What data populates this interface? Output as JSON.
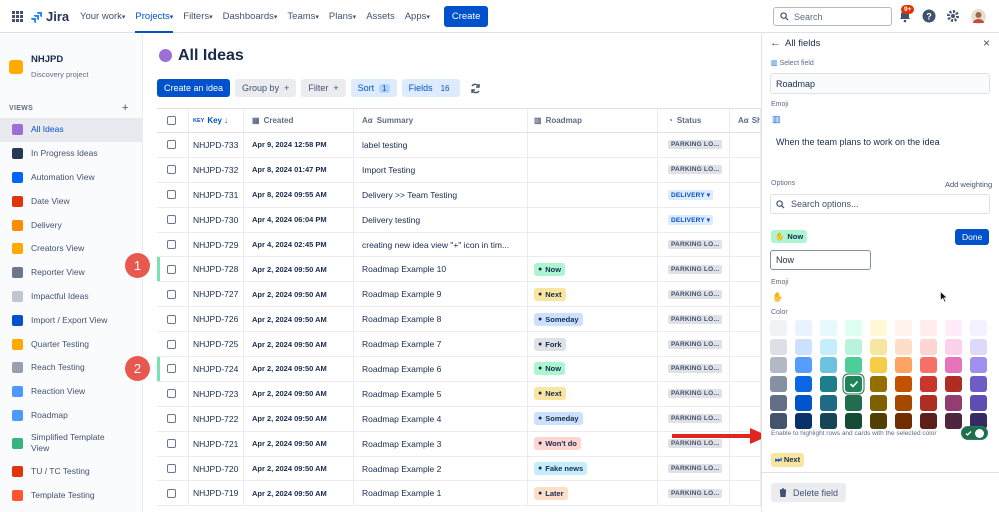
{
  "topbar": {
    "logo": "Jira",
    "nav": [
      "Your work",
      "Projects",
      "Filters",
      "Dashboards",
      "Teams",
      "Plans",
      "Assets",
      "Apps"
    ],
    "create": "Create",
    "search_placeholder": "Search",
    "badge": "9+"
  },
  "sidebar": {
    "project_name": "NHJPD",
    "project_type": "Discovery project",
    "views_header": "VIEWS",
    "views": [
      {
        "label": "All Ideas",
        "color": "#9d6fd6"
      },
      {
        "label": "In Progress Ideas",
        "color": "#253858"
      },
      {
        "label": "Automation View",
        "color": "#0065ff"
      },
      {
        "label": "Date View",
        "color": "#de350b"
      },
      {
        "label": "Delivery",
        "color": "#ff8b00"
      },
      {
        "label": "Creators View",
        "color": "#ffab00"
      },
      {
        "label": "Reporter View",
        "color": "#6b778c"
      },
      {
        "label": "Impactful Ideas",
        "color": "#c1c7d0"
      },
      {
        "label": "Import / Export View",
        "color": "#0052cc"
      },
      {
        "label": "Quarter Testing",
        "color": "#ffab00"
      },
      {
        "label": "Reach Testing",
        "color": "#97a0af"
      },
      {
        "label": "Reaction View",
        "color": "#4c9aff"
      },
      {
        "label": "Roadmap",
        "color": "#4c9aff"
      },
      {
        "label": "Simplified Template View",
        "color": "#36b37e"
      },
      {
        "label": "TU / TC Testing",
        "color": "#de350b"
      },
      {
        "label": "Template Testing",
        "color": "#ff5630"
      }
    ],
    "callout_1": "1",
    "callout_2": "2"
  },
  "main": {
    "title": "All Ideas",
    "toolbar": {
      "create": "Create an idea",
      "group_by": "Group by",
      "filter": "Filter",
      "sort": "Sort",
      "sort_count": "1",
      "fields": "Fields",
      "fields_count": "16"
    },
    "columns": {
      "key": "Key",
      "created": "Created",
      "summary": "Summary",
      "roadmap": "Roadmap",
      "status": "Status",
      "ashort": "Sh"
    },
    "rows": [
      {
        "key": "NHJPD-733",
        "created": "Apr 9, 2024 12:58 PM",
        "summary": "label testing",
        "roadmap": "",
        "roadmap_color": "",
        "status": "PARKING LO...",
        "deliv": false,
        "hl": false
      },
      {
        "key": "NHJPD-732",
        "created": "Apr 8, 2024 01:47 PM",
        "summary": "Import Testing",
        "roadmap": "",
        "roadmap_color": "",
        "status": "PARKING LO...",
        "deliv": false,
        "hl": false
      },
      {
        "key": "NHJPD-731",
        "created": "Apr 8, 2024 09:55 AM",
        "summary": "Delivery >> Team Testing",
        "roadmap": "",
        "roadmap_color": "",
        "status": "DELIVERY",
        "deliv": true,
        "hl": false
      },
      {
        "key": "NHJPD-730",
        "created": "Apr 4, 2024 06:04 PM",
        "summary": "Delivery testing",
        "roadmap": "",
        "roadmap_color": "",
        "status": "DELIVERY",
        "deliv": true,
        "hl": false
      },
      {
        "key": "NHJPD-729",
        "created": "Apr 4, 2024 02:45 PM",
        "summary": "creating new idea view \"+\" icon in tim...",
        "roadmap": "",
        "roadmap_color": "",
        "status": "PARKING LO...",
        "deliv": false,
        "hl": false
      },
      {
        "key": "NHJPD-728",
        "created": "Apr 2, 2024 09:50 AM",
        "summary": "Roadmap Example 10",
        "roadmap": "Now",
        "roadmap_color": "#abf5d1",
        "status": "PARKING LO...",
        "deliv": false,
        "hl": true
      },
      {
        "key": "NHJPD-727",
        "created": "Apr 2, 2024 09:50 AM",
        "summary": "Roadmap Example 9",
        "roadmap": "Next",
        "roadmap_color": "#f8e6a0",
        "status": "PARKING LO...",
        "deliv": false,
        "hl": false
      },
      {
        "key": "NHJPD-726",
        "created": "Apr 2, 2024 09:50 AM",
        "summary": "Roadmap Example 8",
        "roadmap": "Someday",
        "roadmap_color": "#cce0ff",
        "status": "PARKING LO...",
        "deliv": false,
        "hl": false
      },
      {
        "key": "NHJPD-725",
        "created": "Apr 2, 2024 09:50 AM",
        "summary": "Roadmap Example 7",
        "roadmap": "Fork",
        "roadmap_color": "#dfe1e6",
        "status": "PARKING LO...",
        "deliv": false,
        "hl": false
      },
      {
        "key": "NHJPD-724",
        "created": "Apr 2, 2024 09:50 AM",
        "summary": "Roadmap Example 6",
        "roadmap": "Now",
        "roadmap_color": "#abf5d1",
        "status": "PARKING LO...",
        "deliv": false,
        "hl": true
      },
      {
        "key": "NHJPD-723",
        "created": "Apr 2, 2024 09:50 AM",
        "summary": "Roadmap Example 5",
        "roadmap": "Next",
        "roadmap_color": "#f8e6a0",
        "status": "PARKING LO...",
        "deliv": false,
        "hl": false
      },
      {
        "key": "NHJPD-722",
        "created": "Apr 2, 2024 09:50 AM",
        "summary": "Roadmap Example 4",
        "roadmap": "Someday",
        "roadmap_color": "#cce0ff",
        "status": "PARKING LO...",
        "deliv": false,
        "hl": false
      },
      {
        "key": "NHJPD-721",
        "created": "Apr 2, 2024 09:50 AM",
        "summary": "Roadmap Example 3",
        "roadmap": "Won't do",
        "roadmap_color": "#ffd5d2",
        "status": "PARKING LO...",
        "deliv": false,
        "hl": false
      },
      {
        "key": "NHJPD-720",
        "created": "Apr 2, 2024 09:50 AM",
        "summary": "Roadmap Example 2",
        "roadmap": "Fake news",
        "roadmap_color": "#c6edfb",
        "status": "PARKING LO...",
        "deliv": false,
        "hl": false
      },
      {
        "key": "NHJPD-719",
        "created": "Apr 2, 2024 09:50 AM",
        "summary": "Roadmap Example 1",
        "roadmap": "Later",
        "roadmap_color": "#fedec8",
        "status": "PARKING LO...",
        "deliv": false,
        "hl": false
      }
    ]
  },
  "panel": {
    "title": "All fields",
    "select_field_label": "Select field",
    "select_field_value": "Roadmap",
    "emoji_label": "Emoji",
    "description": "When the team plans to work on the idea",
    "options_label": "Options",
    "add_weighting": "Add weighting",
    "search_options": "Search options...",
    "now_chip": "Now",
    "done": "Done",
    "option_name": "Now",
    "emoji_label2": "Emoji",
    "color_label": "Color",
    "enable_text": "Enable to highlight rows and cards with the selected color",
    "next_chip": "Next",
    "delete_field": "Delete field",
    "swatches": [
      [
        "#f1f2f4",
        "#e9f2ff",
        "#e7f9ff",
        "#dcfff1",
        "#fff7d6",
        "#fff3eb",
        "#ffeceb",
        "#ffecf8",
        "#f3f0ff"
      ],
      [
        "#dcdfe4",
        "#cce0ff",
        "#c6edfb",
        "#baf3db",
        "#f8e6a0",
        "#fedec8",
        "#ffd5d2",
        "#fdd0ec",
        "#dfd8fd"
      ],
      [
        "#b3b9c4",
        "#579dff",
        "#6cc3e0",
        "#4bce97",
        "#f5cd47",
        "#fea362",
        "#f87168",
        "#e774bb",
        "#9f8fef"
      ],
      [
        "#8590a2",
        "#0c66e4",
        "#1d7f8c",
        "#1f845a",
        "#946f00",
        "#c25100",
        "#c9372c",
        "#ae2e24",
        "#6e5dc6"
      ],
      [
        "#626f86",
        "#0055cc",
        "#206a83",
        "#216e4e",
        "#7f5f01",
        "#a54800",
        "#ae2e24",
        "#943d73",
        "#5e4db2"
      ],
      [
        "#44546f",
        "#09326c",
        "#164555",
        "#164b35",
        "#533f04",
        "#702e00",
        "#5d1f1a",
        "#50253f",
        "#352c63"
      ]
    ],
    "selected_swatch_row": 3,
    "selected_swatch_col": 3
  }
}
